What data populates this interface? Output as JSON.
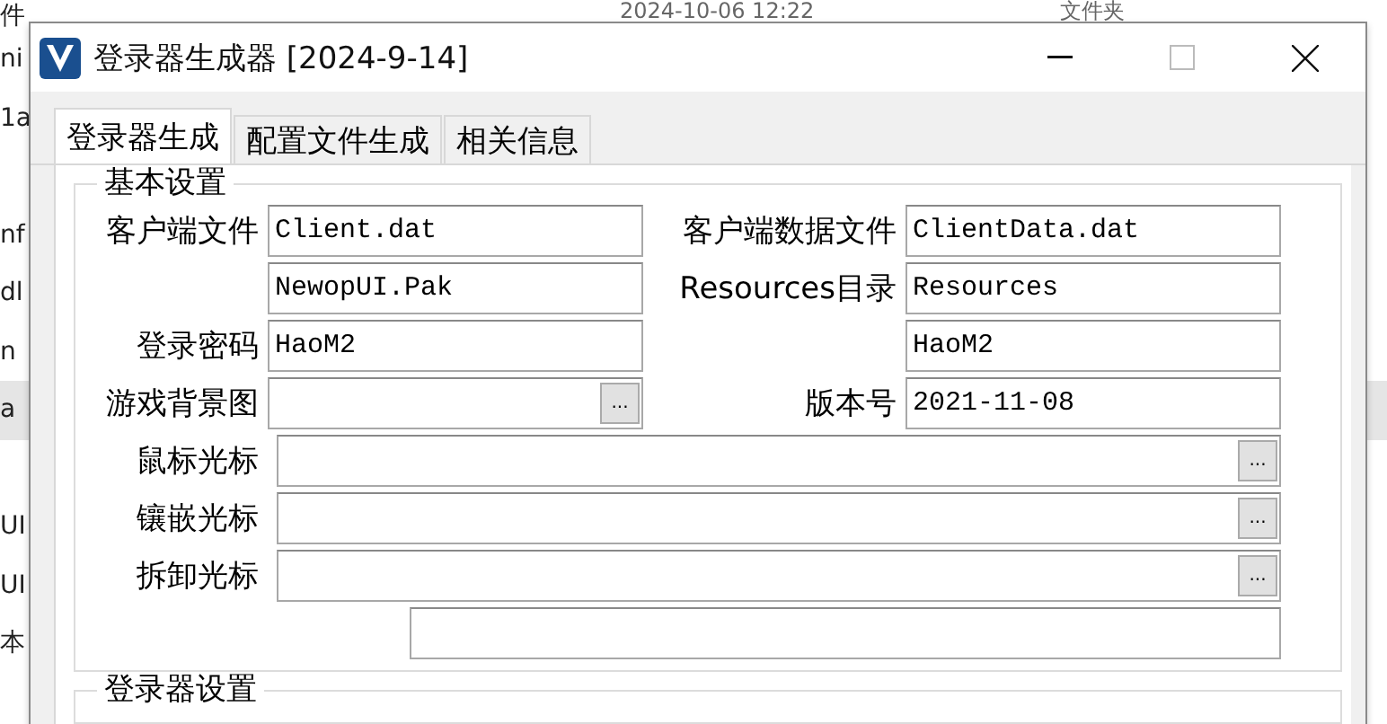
{
  "explorer": {
    "rows": [
      {
        "name": "件",
        "date": "2024-10-06 12:22",
        "type": "文件夹",
        "selected": false
      },
      {
        "name": "ni",
        "selected": false
      },
      {
        "name": "1a",
        "selected": false
      },
      {
        "selected": false
      },
      {
        "name": "nf",
        "selected": false
      },
      {
        "name": "dl",
        "selected": false
      },
      {
        "name": "n",
        "selected": false
      },
      {
        "name": "a",
        "selected": true
      },
      {
        "selected": false
      },
      {
        "name": "UI",
        "selected": false
      },
      {
        "name": "UI",
        "selected": false
      },
      {
        "name": "本",
        "selected": false
      }
    ]
  },
  "window": {
    "title": "登录器生成器 [2024-9-14]"
  },
  "tabs": [
    {
      "label": "登录器生成",
      "selected": true
    },
    {
      "label": "配置文件生成",
      "selected": false
    },
    {
      "label": "相关信息",
      "selected": false
    }
  ],
  "groups": [
    {
      "title": "基本设置",
      "rows": [
        {
          "kind": "pair",
          "fields": [
            {
              "label": "客户端文件",
              "value": "Client.dat"
            },
            {
              "label": "客户端数据文件",
              "value": "ClientData.dat"
            }
          ]
        },
        {
          "kind": "pair",
          "fields": [
            {
              "value": "NewopUI.Pak"
            },
            {
              "label": "Resources目录",
              "value": "Resources"
            }
          ]
        },
        {
          "kind": "pair",
          "fields": [
            {
              "label": "登录密码",
              "value": "HaoM2"
            },
            {
              "value": "HaoM2"
            }
          ]
        },
        {
          "kind": "pair",
          "fields": [
            {
              "label": "游戏背景图",
              "button": "..."
            },
            {
              "label": "版本号",
              "value": "2021-11-08"
            }
          ]
        },
        {
          "kind": "wide",
          "fields": [
            {
              "label": "鼠标光标",
              "button": "..."
            }
          ]
        },
        {
          "kind": "wide",
          "fields": [
            {
              "label": "镶嵌光标",
              "button": "..."
            }
          ]
        },
        {
          "kind": "wide",
          "fields": [
            {
              "label": "拆卸光标",
              "button": "..."
            }
          ]
        },
        {
          "kind": "tail"
        }
      ]
    },
    {
      "title": "登录器设置"
    }
  ]
}
